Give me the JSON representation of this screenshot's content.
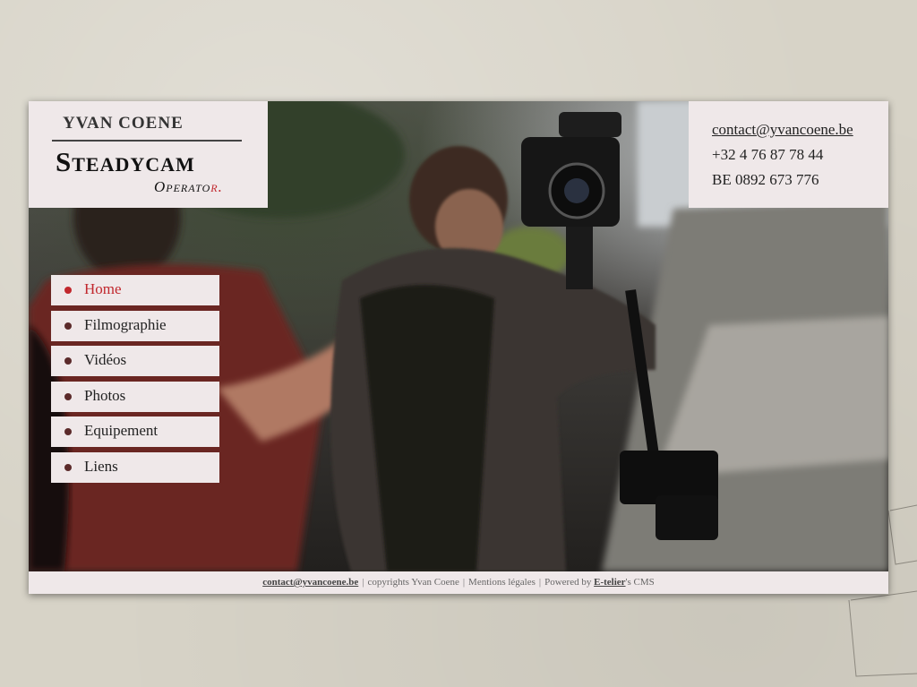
{
  "header": {
    "name": "YVAN COENE",
    "title": "Steadycam",
    "subtitle_main": "Operato",
    "subtitle_accent": "r."
  },
  "contact": {
    "email": "contact@yvancoene.be",
    "phone": "+32 4 76 87 78 44",
    "vat": "BE 0892 673 776"
  },
  "nav": {
    "items": [
      {
        "label": "Home"
      },
      {
        "label": "Filmographie"
      },
      {
        "label": "Vidéos"
      },
      {
        "label": "Photos"
      },
      {
        "label": "Equipement"
      },
      {
        "label": "Liens"
      }
    ]
  },
  "footer": {
    "email": "contact@yvancoene.be",
    "copyright": "copyrights Yvan Coene",
    "legal": "Mentions légales",
    "powered_prefix": "Powered by",
    "powered_link": "E-telier",
    "powered_suffix": "'s CMS"
  },
  "colors": {
    "accent": "#c1272d",
    "panel": "#efe8e9",
    "page_bg": "#d7d3c7"
  }
}
